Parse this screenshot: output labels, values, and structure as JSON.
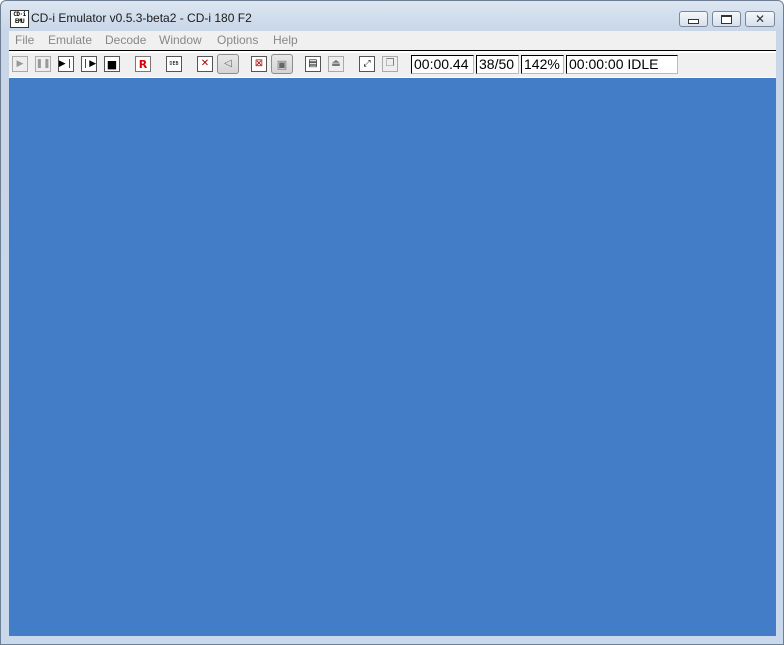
{
  "window": {
    "title": "CD-i Emulator v0.5.3-beta2 - CD-i 180 F2",
    "app_icon_text_1": "CD·i",
    "app_icon_text_2": "EMU"
  },
  "menu": [
    {
      "label": "File"
    },
    {
      "label": "Emulate"
    },
    {
      "label": "Decode"
    },
    {
      "label": "Window"
    },
    {
      "label": "Options"
    },
    {
      "label": "Help"
    }
  ],
  "toolbar": {
    "record_label": "R",
    "debug_label": "DEB"
  },
  "status": {
    "time": "00:00.44",
    "frames": "38/50",
    "speed": "142%",
    "state": "00:00:00 IDLE"
  },
  "colors": {
    "display": "#437cc7",
    "menu_text_disabled": "#888888"
  }
}
